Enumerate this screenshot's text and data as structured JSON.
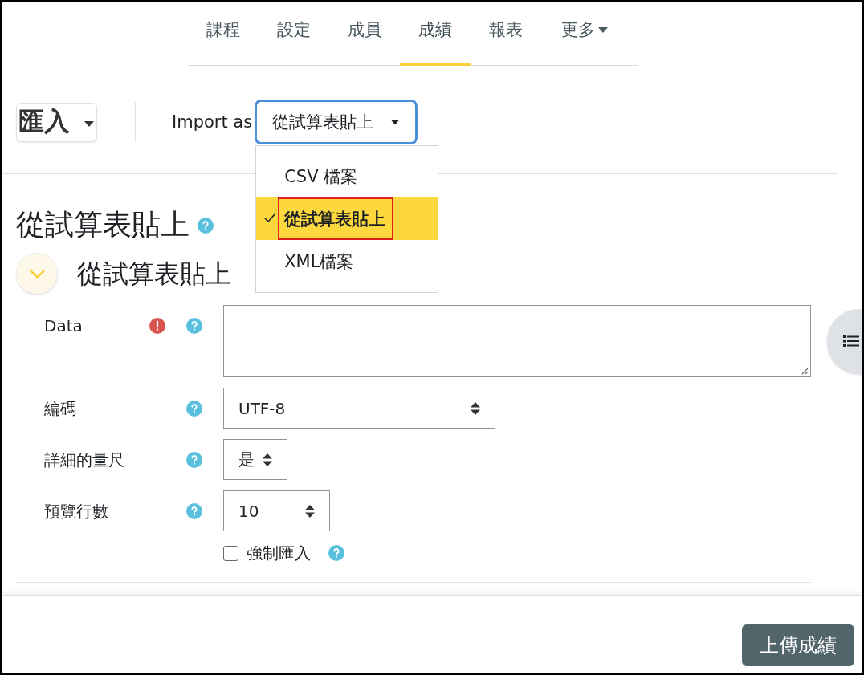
{
  "nav": {
    "tabs": [
      {
        "label": "課程",
        "selected": false,
        "kind": "link"
      },
      {
        "label": "設定",
        "selected": false,
        "kind": "link"
      },
      {
        "label": "成員",
        "selected": false,
        "kind": "link"
      },
      {
        "label": "成績",
        "selected": true,
        "kind": "link"
      },
      {
        "label": "報表",
        "selected": false,
        "kind": "link"
      },
      {
        "label": "更多",
        "selected": false,
        "kind": "menu"
      }
    ]
  },
  "toolbar": {
    "action_menu": {
      "label": "匯入"
    },
    "import_as": {
      "label": "Import as",
      "value": "從試算表貼上",
      "focused": true,
      "open": true,
      "options": [
        {
          "label": "CSV 檔案",
          "selected": false,
          "annotated": false
        },
        {
          "label": "從試算表貼上",
          "selected": true,
          "annotated": true
        },
        {
          "label": "XML檔案",
          "selected": false,
          "annotated": false
        }
      ]
    }
  },
  "page_title": {
    "text": "從試算表貼上",
    "help": true
  },
  "section": {
    "title": "從試算表貼上",
    "expanded": true
  },
  "form": {
    "fields": [
      {
        "kind": "textarea",
        "label": "Data",
        "required": true,
        "help": true
      },
      {
        "kind": "select",
        "label": "編碼",
        "required": false,
        "help": true,
        "value": "UTF-8"
      },
      {
        "kind": "select",
        "label": "詳細的量尺",
        "required": false,
        "help": true,
        "value": "是"
      },
      {
        "kind": "select",
        "label": "預覽行數",
        "required": false,
        "help": true,
        "value": "10"
      },
      {
        "kind": "checkbox",
        "label": "強制匯入",
        "required": false,
        "help": true,
        "checked": false
      }
    ]
  },
  "footer": {
    "submit_button": "上傳成績"
  }
}
